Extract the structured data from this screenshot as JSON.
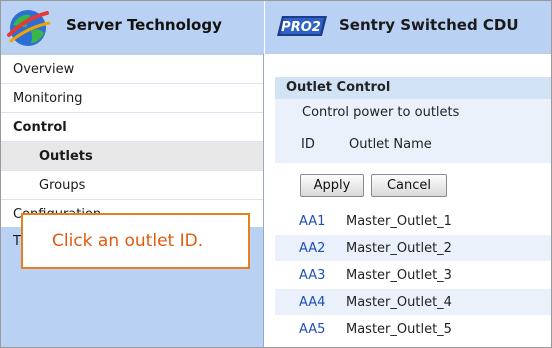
{
  "brand": {
    "name": "Server Technology",
    "logo_icon": "globe-logo-icon"
  },
  "header": {
    "badge": "PRO2",
    "title": "Sentry Switched CDU"
  },
  "nav": {
    "items": [
      {
        "label": "Overview"
      },
      {
        "label": "Monitoring"
      },
      {
        "label": "Control"
      },
      {
        "label": "Outlets"
      },
      {
        "label": "Groups"
      },
      {
        "label": "Configuration"
      },
      {
        "label": "T"
      }
    ]
  },
  "panel": {
    "title": "Outlet Control",
    "subtitle": "Control power to outlets",
    "columns": {
      "id": "ID",
      "name": "Outlet Name"
    },
    "apply_label": "Apply",
    "cancel_label": "Cancel",
    "rows": [
      {
        "id": "AA1",
        "name": "Master_Outlet_1"
      },
      {
        "id": "AA2",
        "name": "Master_Outlet_2"
      },
      {
        "id": "AA3",
        "name": "Master_Outlet_3"
      },
      {
        "id": "AA4",
        "name": "Master_Outlet_4"
      },
      {
        "id": "AA5",
        "name": "Master_Outlet_5"
      }
    ]
  },
  "callout": {
    "text": "Click an outlet ID."
  },
  "colors": {
    "sidebar": "#b9d2f3",
    "link": "#1f4fb5",
    "callout_border": "#e67e22",
    "callout_text": "#e15a10"
  }
}
